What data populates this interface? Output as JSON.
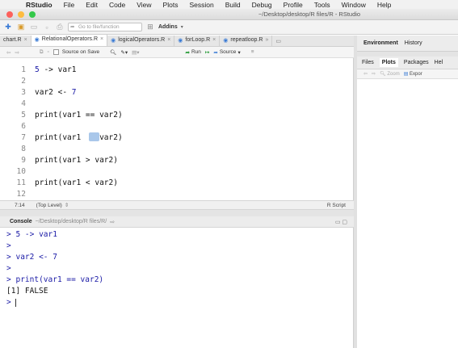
{
  "menubar": {
    "app": "RStudio",
    "items": [
      "File",
      "Edit",
      "Code",
      "View",
      "Plots",
      "Session",
      "Build",
      "Debug",
      "Profile",
      "Tools",
      "Window",
      "Help"
    ]
  },
  "window": {
    "title": "~/Desktop/desktop/R files/R - RStudio",
    "colors": {
      "close": "#fc605b",
      "min": "#fdbc40",
      "max": "#34c84a"
    }
  },
  "toolbar": {
    "goto_placeholder": "Go to file/function",
    "addins": "Addins"
  },
  "editor_tabs": [
    {
      "label": "chart.R",
      "active": false
    },
    {
      "label": "RelationalOperators.R",
      "active": true
    },
    {
      "label": "logicalOperators.R",
      "active": false
    },
    {
      "label": "forLoop.R",
      "active": false
    },
    {
      "label": "repeatloop.R",
      "active": false
    }
  ],
  "editor_toolbar": {
    "source_on_save": "Source on Save",
    "run": "Run",
    "source": "Source"
  },
  "editor_lines": [
    {
      "n": "1",
      "code": "5 -> var1"
    },
    {
      "n": "2",
      "code": ""
    },
    {
      "n": "3",
      "code": "var2 <- 7"
    },
    {
      "n": "4",
      "code": ""
    },
    {
      "n": "5",
      "code": "print(var1 == var2)"
    },
    {
      "n": "6",
      "code": ""
    },
    {
      "n": "7",
      "code": "print(var1    var2)"
    },
    {
      "n": "8",
      "code": ""
    },
    {
      "n": "9",
      "code": "print(var1 > var2)"
    },
    {
      "n": "10",
      "code": ""
    },
    {
      "n": "11",
      "code": "print(var1 < var2)"
    },
    {
      "n": "12",
      "code": ""
    }
  ],
  "editor_status": {
    "position": "7:14",
    "scope": "(Top Level)",
    "type": "R Script"
  },
  "console": {
    "title": "Console",
    "path": "~/Desktop/desktop/R files/R/",
    "lines": [
      {
        "prompt": ">",
        "text": "5 -> var1",
        "kind": "cmd"
      },
      {
        "prompt": ">",
        "text": "",
        "kind": "cmd"
      },
      {
        "prompt": ">",
        "text": "var2 <- 7",
        "kind": "cmd"
      },
      {
        "prompt": ">",
        "text": "",
        "kind": "cmd"
      },
      {
        "prompt": ">",
        "text": "print(var1 == var2)",
        "kind": "cmd"
      },
      {
        "prompt": "",
        "text": "[1] FALSE",
        "kind": "out"
      },
      {
        "prompt": ">",
        "text": "",
        "kind": "cmd"
      }
    ]
  },
  "right_top": {
    "tabs": [
      "Environment",
      "History"
    ]
  },
  "right_bottom": {
    "tabs": [
      "Files",
      "Plots",
      "Packages",
      "Hel"
    ],
    "active": "Plots",
    "zoom": "Zoom",
    "export": "Expor"
  }
}
